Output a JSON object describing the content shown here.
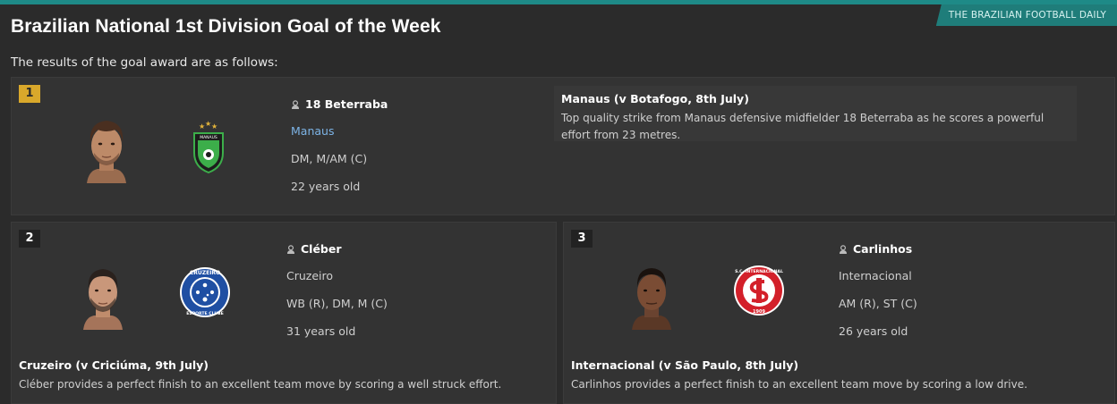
{
  "header": {
    "source": "THE BRAZILIAN FOOTBALL DAILY",
    "title": "Brazilian National 1st Division Goal of the Week",
    "intro": "The results of the goal award are as follows:"
  },
  "colors": {
    "accent": "#1e8a87",
    "gold_rank": "#d9a82b",
    "link": "#7db4e6"
  },
  "entries": [
    {
      "rank": "1",
      "player": "18 Beterraba",
      "club": "Manaus",
      "positions": "DM, M/AM (C)",
      "age": "22 years old",
      "match": "Manaus (v Botafogo, 8th July)",
      "description": "Top quality strike from Manaus defensive midfielder 18 Beterraba as he scores a powerful effort from 23 metres."
    },
    {
      "rank": "2",
      "player": "Cléber",
      "club": "Cruzeiro",
      "positions": "WB (R), DM, M (C)",
      "age": "31 years old",
      "match": "Cruzeiro (v Criciúma, 9th July)",
      "description": "Cléber provides a perfect finish to an excellent team move by scoring a well struck effort."
    },
    {
      "rank": "3",
      "player": "Carlinhos",
      "club": "Internacional",
      "positions": "AM (R), ST (C)",
      "age": "26 years old",
      "match": "Internacional (v São Paulo, 8th July)",
      "description": "Carlinhos provides a perfect finish to an excellent team move by scoring a low drive."
    }
  ],
  "crests": {
    "manaus": "MANAUS",
    "cruzeiro_top": "CRUZEIRO",
    "cruzeiro_bottom": "ESPORTE CLUBE",
    "internacional": "S.C. INTERNACIONAL",
    "internacional_year": "1909"
  }
}
